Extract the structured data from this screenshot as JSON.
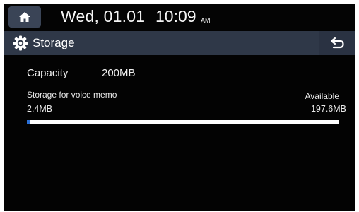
{
  "status": {
    "home_icon": "home-icon",
    "date": "Wed, 01.01",
    "time": "10:09",
    "ampm": "AM"
  },
  "header": {
    "settings_icon": "gear-icon",
    "title": "Storage",
    "back_icon": "back-arrow-icon"
  },
  "storage": {
    "capacity_label": "Capacity",
    "capacity_value": "200MB",
    "voice_memo_label": "Storage for voice memo",
    "used_value": "2.4MB",
    "available_label": "Available",
    "available_value": "197.6MB",
    "used_fraction": 0.012
  },
  "colors": {
    "screen_bg": "#030303",
    "title_bar_bg": "#2f3848",
    "home_button_bg": "#3a4456",
    "bar_track": "#ffffff",
    "bar_fill": "#2a6fd6"
  }
}
